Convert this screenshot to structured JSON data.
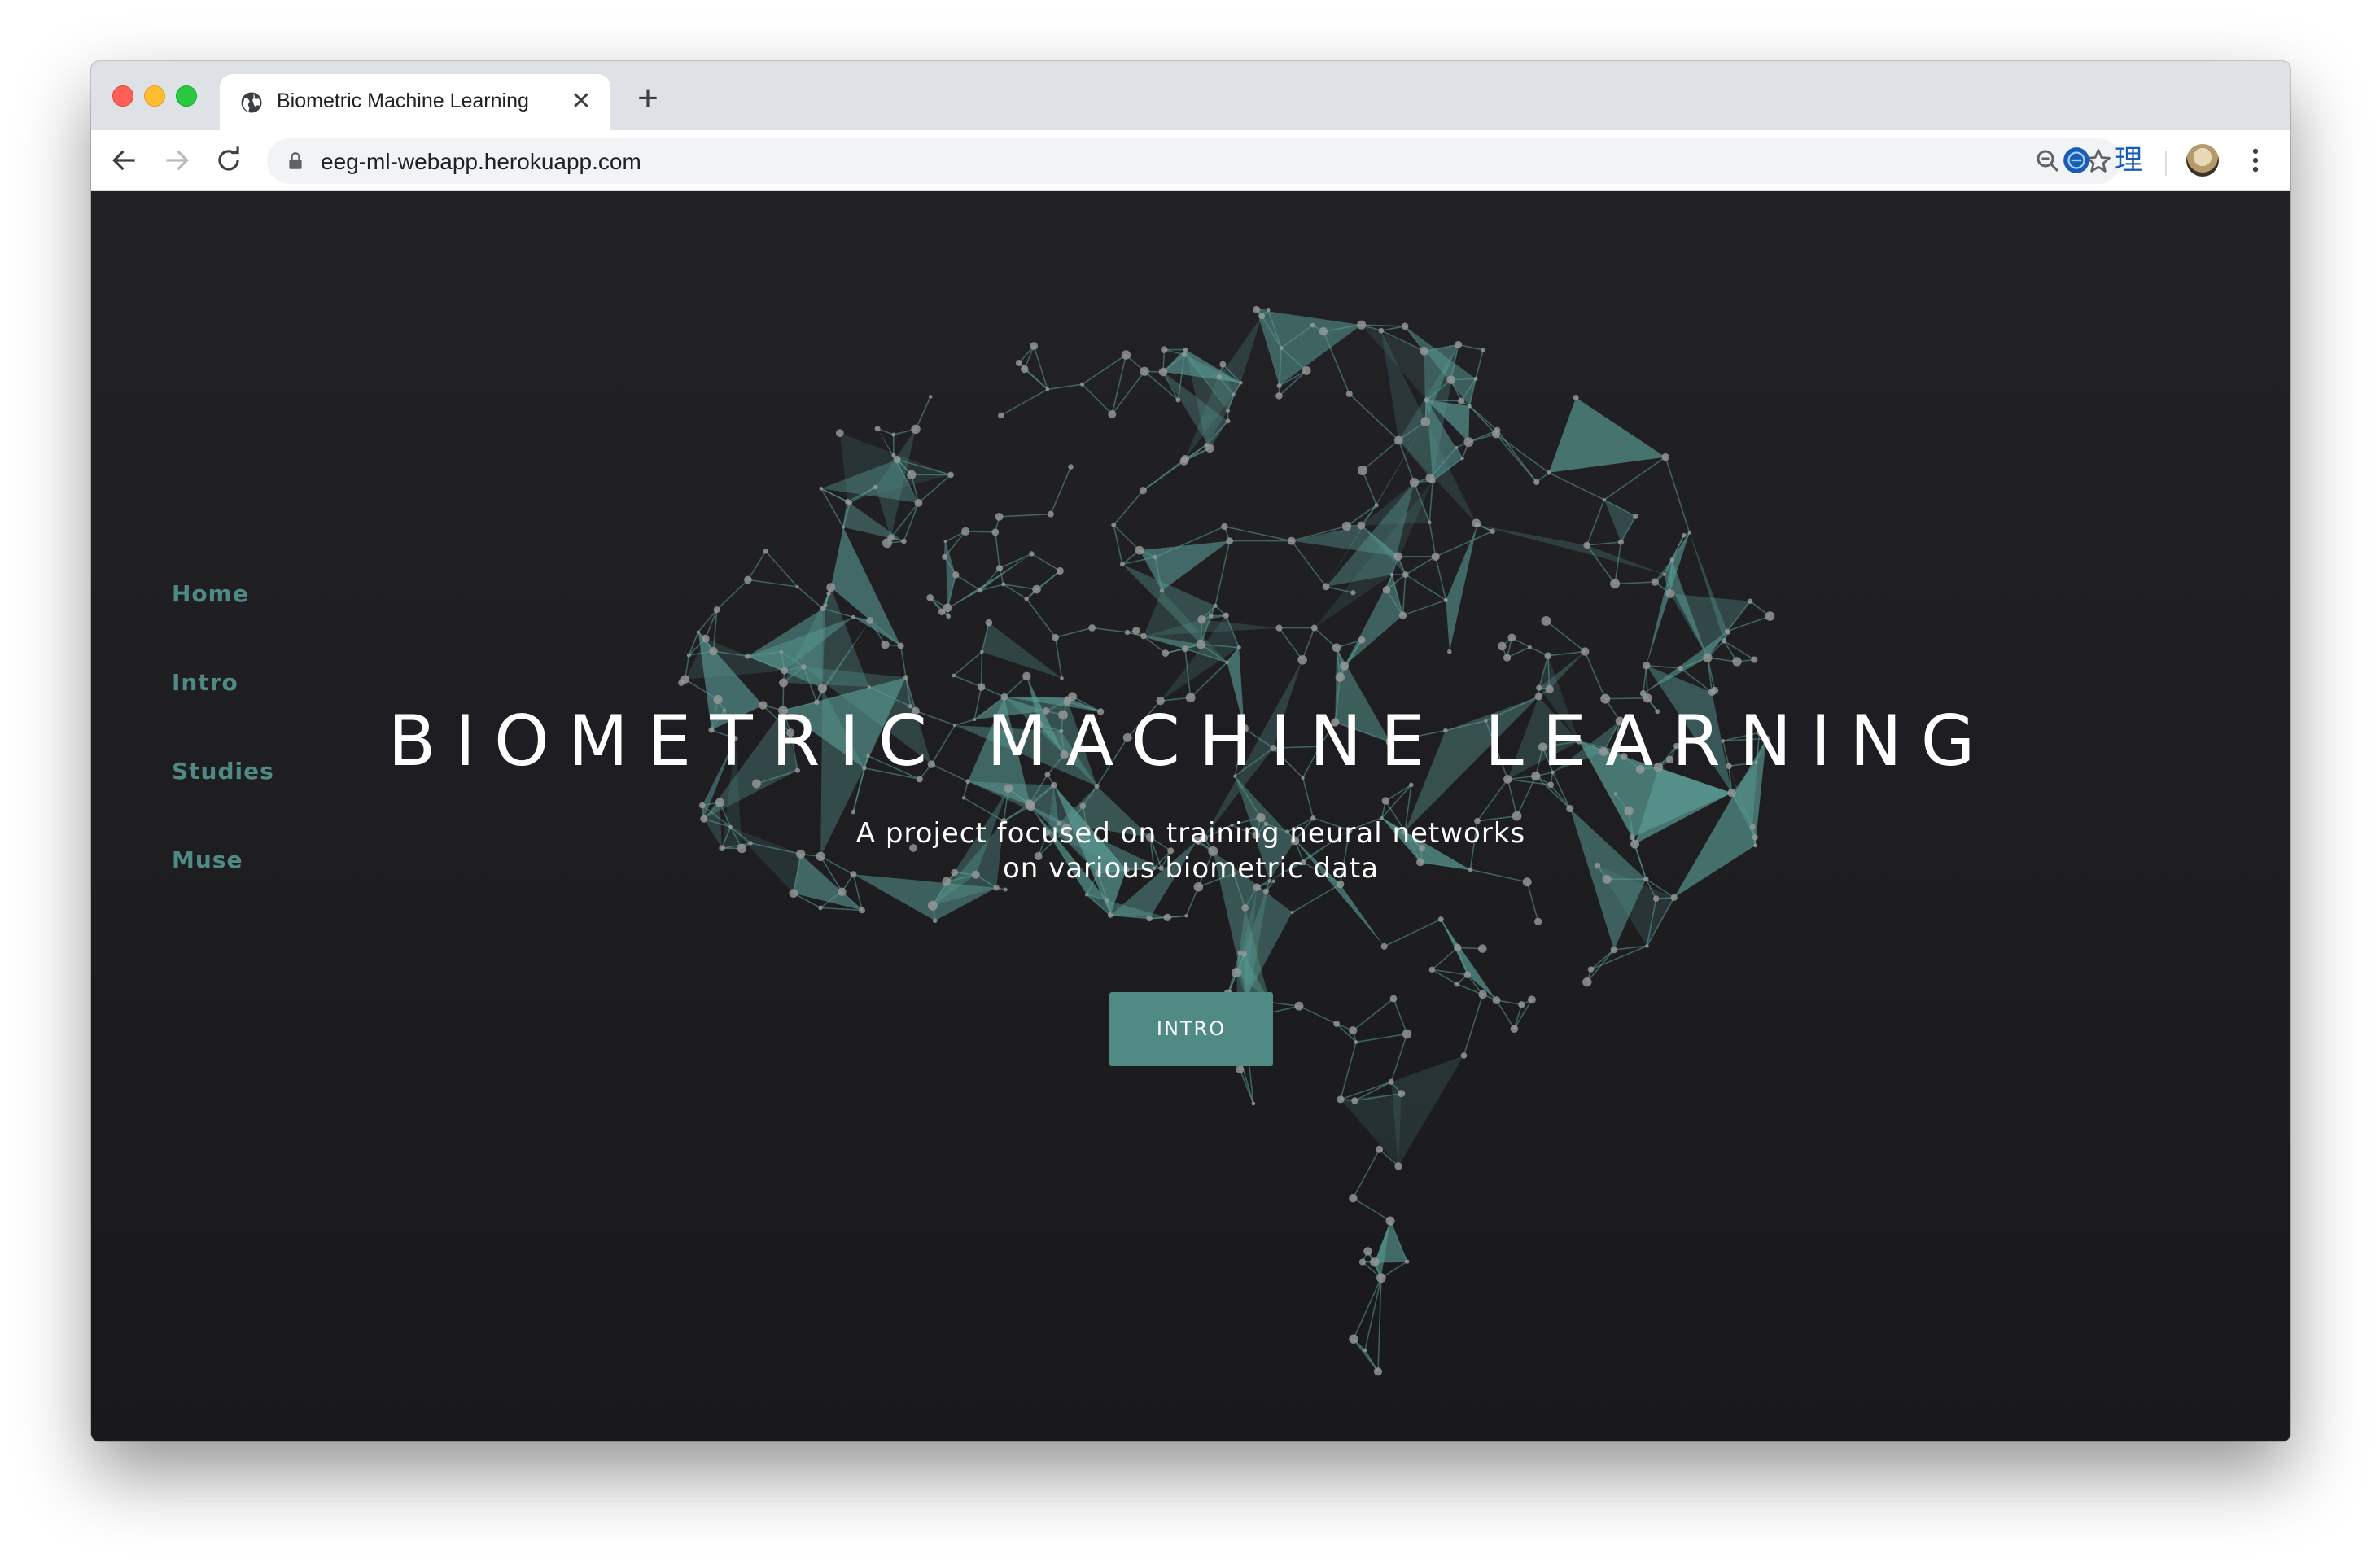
{
  "browser": {
    "tab": {
      "title": "Biometric Machine Learning",
      "close_glyph": "✕",
      "favicon": "globe-icon"
    },
    "new_tab_glyph": "+",
    "url": "eeg-ml-webapp.herokuapp.com",
    "toolbar_icons": [
      "back-arrow-icon",
      "forward-arrow-icon",
      "reload-icon",
      "lock-icon",
      "zoom-icon",
      "bookmark-star-icon",
      "extension-globe-icon",
      "extension-kanji-icon",
      "profile-avatar",
      "kebab-menu-icon"
    ],
    "extension_kanji": "理"
  },
  "page": {
    "nav": [
      {
        "label": "Home"
      },
      {
        "label": "Intro"
      },
      {
        "label": "Studies"
      },
      {
        "label": "Muse"
      }
    ],
    "hero": {
      "title": "BIOMETRIC MACHINE LEARNING",
      "subtitle_line1": "A project focused on training neural networks",
      "subtitle_line2": "on various biometric data",
      "button_label": "INTRO"
    },
    "colors": {
      "accent": "#4f8a85",
      "background": "#1e1e21",
      "network_line": "#5a9b94",
      "node": "#9a9a9a"
    },
    "background_graphic": "polygon-brain-network"
  }
}
